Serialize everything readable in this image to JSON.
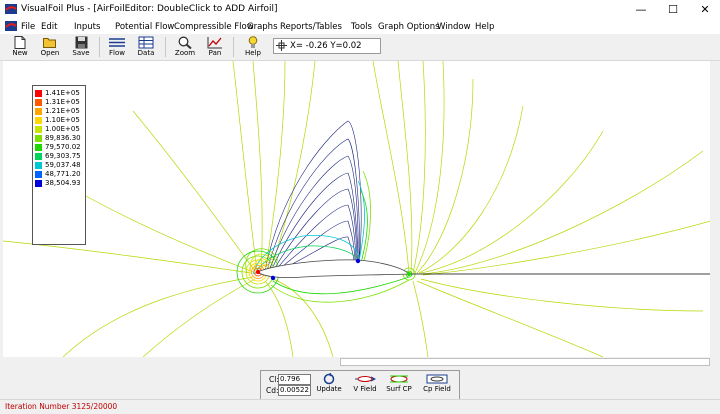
{
  "window": {
    "title": "VisualFoil Plus - [AirFoilEditor: DoubleClick to ADD Airfoil]",
    "minimize": "—",
    "maximize": "☐",
    "close": "✕"
  },
  "menu": {
    "items": [
      "File",
      "Edit",
      "Inputs",
      "Potential Flow",
      "Compressible Flow",
      "Graphs",
      "Reports/Tables",
      "Tools",
      "Graph Options",
      "Window",
      "Help"
    ]
  },
  "toolbar": {
    "buttons": [
      {
        "label": "New",
        "icon": "new-file-icon"
      },
      {
        "label": "Open",
        "icon": "open-folder-icon"
      },
      {
        "label": "Save",
        "icon": "save-disk-icon"
      },
      {
        "label": "Flow",
        "icon": "flow-lines-icon"
      },
      {
        "label": "Data",
        "icon": "data-table-icon"
      },
      {
        "label": "Zoom",
        "icon": "zoom-magnifier-icon"
      },
      {
        "label": "Pan",
        "icon": "pan-chart-icon"
      },
      {
        "label": "Help",
        "icon": "help-bulb-icon"
      }
    ],
    "coordinate_readout": "X= -0.26  Y=0.02"
  },
  "legend": {
    "entries": [
      {
        "value": "1.41E+05",
        "color": "#ff0000"
      },
      {
        "value": "1.31E+05",
        "color": "#ff5a00"
      },
      {
        "value": "1.21E+05",
        "color": "#ffa500"
      },
      {
        "value": "1.10E+05",
        "color": "#ffd800"
      },
      {
        "value": "1.00E+05",
        "color": "#c8e600"
      },
      {
        "value": "89,836.30",
        "color": "#7ee000"
      },
      {
        "value": "79,570.02",
        "color": "#1ed800"
      },
      {
        "value": "69,303.75",
        "color": "#00d45a"
      },
      {
        "value": "59,037.48",
        "color": "#00c8d2"
      },
      {
        "value": "48,771.20",
        "color": "#0064ff"
      },
      {
        "value": "38,504.93",
        "color": "#0000d8"
      }
    ]
  },
  "results": {
    "cl_label": "Cl:",
    "cl_value": "0.796",
    "cd_label": "Cd:",
    "cd_value": "0.00522"
  },
  "panel_buttons": [
    {
      "label": "Update",
      "icon": "update-icon"
    },
    {
      "label": "V Field",
      "icon": "velocity-field-icon"
    },
    {
      "label": "Surf CP",
      "icon": "surface-cp-icon"
    },
    {
      "label": "Cp Field",
      "icon": "cp-field-icon"
    }
  ],
  "status": {
    "text": "Iteration Number 3125/20000"
  }
}
